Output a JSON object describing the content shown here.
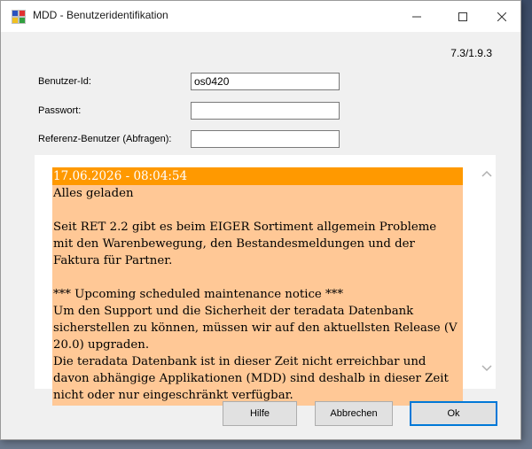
{
  "window": {
    "title": "MDD - Benutzeridentifikation",
    "version": "7.3/1.9.3"
  },
  "form": {
    "user_id_label": "Benutzer-Id:",
    "user_id_value": "os0420",
    "password_label": "Passwort:",
    "password_value": "",
    "reference_label": "Referenz-Benutzer (Abfragen):",
    "reference_value": ""
  },
  "message": {
    "header": "17.06.2026 - 08:04:54",
    "body": "Alles geladen\n\nSeit RET 2.2 gibt es beim EIGER Sortiment allgemein Probleme mit den Warenbewegung, den Bestandesmeldungen und der Faktura für Partner.\n\n*** Upcoming scheduled maintenance notice ***\nUm den Support und die Sicherheit der teradata Datenbank sicherstellen zu können, müssen wir auf den aktuellsten Release (V 20.0) upgraden.\nDie teradata Datenbank ist in dieser Zeit nicht erreichbar und davon abhängige Applikationen (MDD) sind deshalb in dieser Zeit nicht oder nur eingeschränkt verfügbar."
  },
  "buttons": {
    "help": "Hilfe",
    "cancel": "Abbrechen",
    "ok": "Ok"
  },
  "colors": {
    "header_bg": "#ff9900",
    "body_bg": "#ffc896",
    "focus": "#0078d7"
  },
  "icons": {
    "app": "app-grid-icon",
    "minimize": "minimize-icon",
    "maximize": "maximize-icon",
    "close": "close-icon",
    "scroll_up": "chevron-up-icon",
    "scroll_down": "chevron-down-icon"
  }
}
